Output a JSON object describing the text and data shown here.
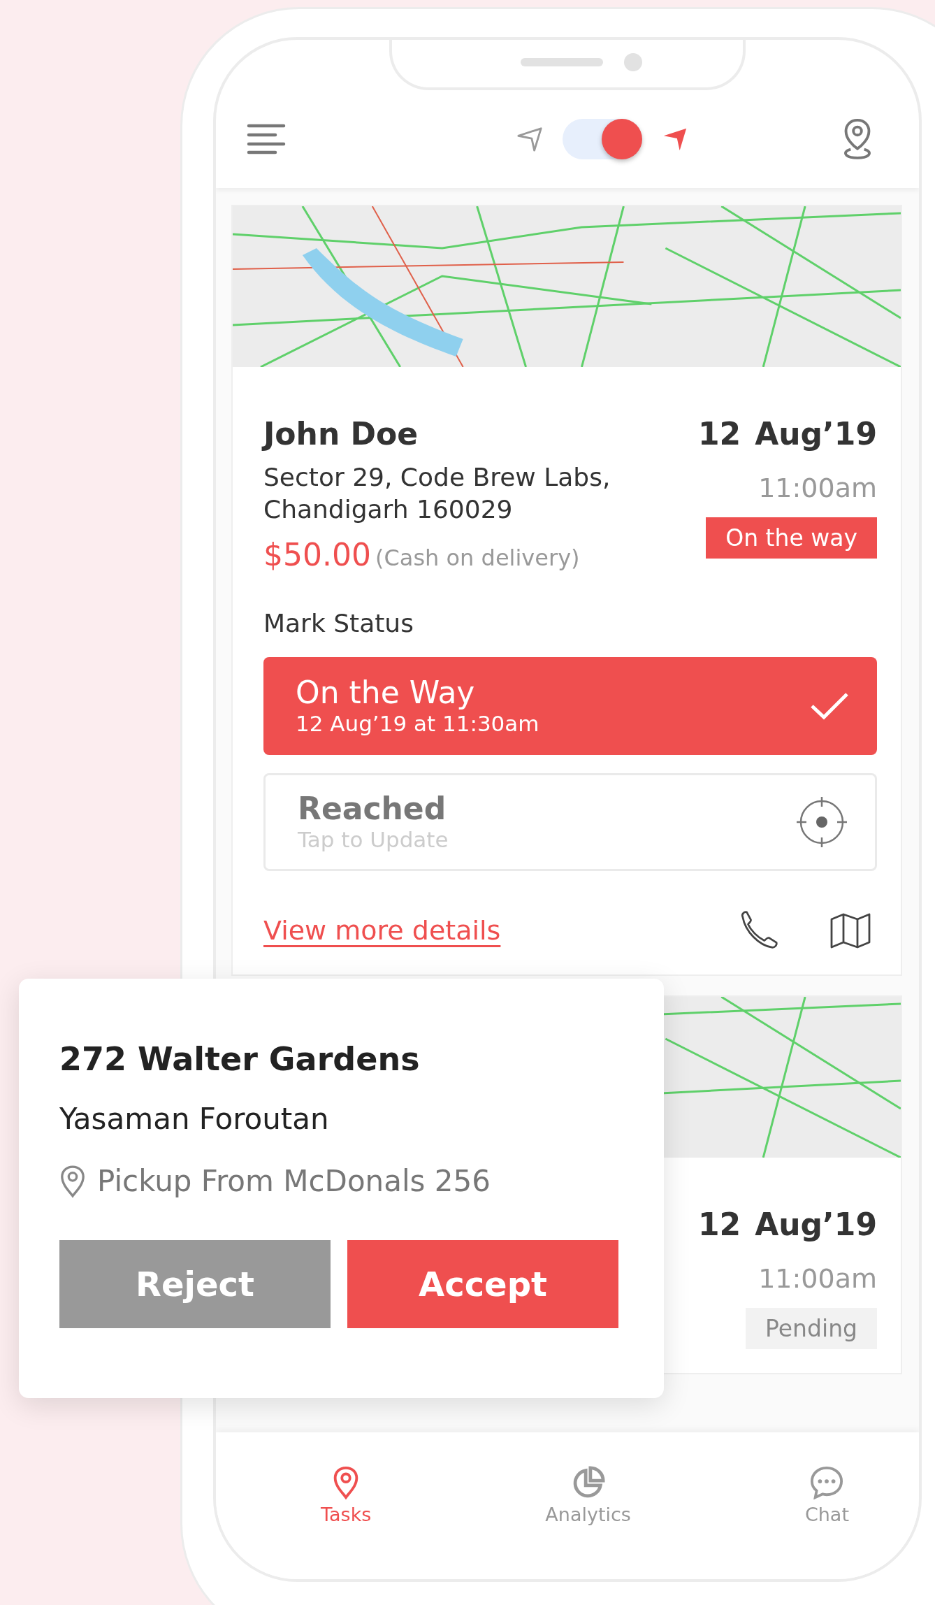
{
  "header": {
    "tracking_toggle": {
      "on": true
    }
  },
  "tasks": [
    {
      "name": "John Doe",
      "address_lines": [
        "Sector 29, Code Brew Labs,",
        "Chandigarh 160029"
      ],
      "price": "$50.00",
      "payment": "(Cash on delivery)",
      "date_day": "12",
      "date_month": "Aug’19",
      "time": "11:00am",
      "status": "On the way",
      "kind": "active",
      "mark_status": {
        "title": "Mark Status",
        "steps": [
          {
            "title": "On the Way",
            "subtitle": "12 Aug’19 at 11:30am",
            "done": true
          },
          {
            "title": "Reached",
            "subtitle": "Tap to Update",
            "done": false
          }
        ]
      },
      "link": "View more details"
    },
    {
      "date_day": "12",
      "date_month": "Aug’19",
      "time": "11:00am",
      "status": "Pending",
      "kind": "pending"
    }
  ],
  "request_popup": {
    "title": "272 Walter Gardens",
    "customer": "Yasaman Foroutan",
    "pickup": "Pickup From McDonals 256",
    "buttons": [
      {
        "label": "Reject",
        "kind": "reject"
      },
      {
        "label": "Accept",
        "kind": "accept"
      }
    ]
  },
  "bottom_nav": [
    {
      "label": "Tasks",
      "kind": "pin",
      "selected": true
    },
    {
      "label": "Analytics",
      "kind": "pie",
      "selected": false
    },
    {
      "label": "Chat",
      "kind": "chat",
      "selected": false
    }
  ]
}
